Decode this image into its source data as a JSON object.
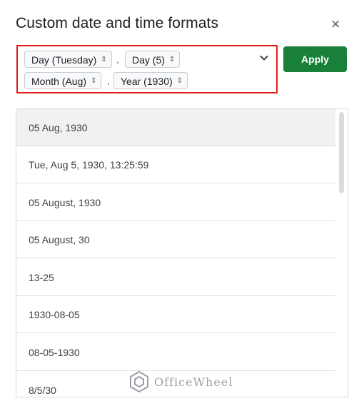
{
  "dialog": {
    "title": "Custom date and time formats",
    "close_icon": "×"
  },
  "format_builder": {
    "chips": [
      {
        "label": "Day (Tuesday)"
      },
      {
        "label": "Day (5)"
      },
      {
        "label": "Month (Aug)"
      },
      {
        "label": "Year (1930)"
      }
    ],
    "separators": [
      ",",
      ","
    ],
    "chip_arrows": "⌃⌄",
    "dropdown_icon": "chevron-down-icon"
  },
  "apply_button": {
    "label": "Apply",
    "color": "#188038"
  },
  "highlight_color": "#e31b1b",
  "formats": [
    {
      "label": "05 Aug, 1930",
      "selected": true
    },
    {
      "label": "Tue, Aug 5, 1930, 13:25:59"
    },
    {
      "label": "05 August, 1930"
    },
    {
      "label": "05 August, 30"
    },
    {
      "label": "13-25"
    },
    {
      "label": "1930-08-05"
    },
    {
      "label": "08-05-1930"
    },
    {
      "label": "8/5/30"
    }
  ],
  "watermark": {
    "text": "OfficeWheel"
  }
}
